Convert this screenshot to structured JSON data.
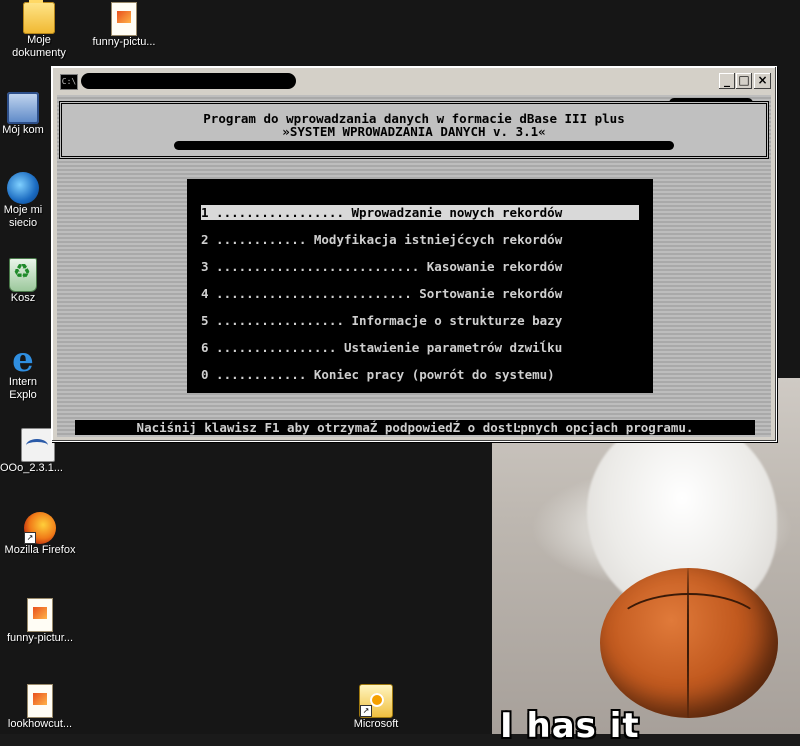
{
  "desktop": {
    "icons": [
      {
        "label": "Moje\ndokumenty",
        "icon": "folder-icon"
      },
      {
        "label": "funny-pictu...",
        "icon": "image-file-icon"
      },
      {
        "label": "Mój kom",
        "icon": "computer-icon"
      },
      {
        "label": "Moje mi\nsiecio",
        "icon": "network-icon"
      },
      {
        "label": "Kosz",
        "icon": "recycle-bin-icon"
      },
      {
        "label": "Intern\nExplo",
        "icon": "internet-explorer-icon"
      },
      {
        "label": "OOo_2.3.1...",
        "icon": "openoffice-icon"
      },
      {
        "label": "Mozilla Firefox",
        "icon": "firefox-icon"
      },
      {
        "label": "funny-pictur...",
        "icon": "image-file-icon"
      },
      {
        "label": "lookhowcut...",
        "icon": "image-file-icon"
      },
      {
        "label": "Microsoft",
        "icon": "outlook-icon"
      }
    ],
    "wallpaper_caption": "I has it"
  },
  "window": {
    "title_icon": "C:\\",
    "buttons": {
      "minimize": "_",
      "maximize": "□",
      "close": "×"
    },
    "header": {
      "line1": "Program do wprowadzania danych w formacie dBase III plus",
      "line2": "»SYSTEM WPROWADZANIA DANYCH v. 3.1«"
    },
    "menu": {
      "items": [
        {
          "text": "1 ................. Wprowadzanie nowych rekordów",
          "selected": true
        },
        {
          "text": "2 ............ Modyfikacja istniejćcych rekordów",
          "selected": false
        },
        {
          "text": "3 ........................... Kasowanie rekordów",
          "selected": false
        },
        {
          "text": "4 .......................... Sortowanie rekordów",
          "selected": false
        },
        {
          "text": "5 ................. Informacje o strukturze bazy",
          "selected": false
        },
        {
          "text": "6 ................ Ustawienie parametrów dzwiĺku",
          "selected": false
        },
        {
          "text": "0 ............ Koniec pracy (powrót do systemu)",
          "selected": false
        }
      ]
    },
    "status": "Naciśnij klawisz F1 aby otrzymaŹ podpowiedŹ o dostĿpnych opcjach programu."
  },
  "colors": {
    "console_bg": "#c0c0c0",
    "menu_bg": "#000000",
    "menu_text": "#cfcfcf",
    "selected_bg": "#d9d9d9"
  }
}
